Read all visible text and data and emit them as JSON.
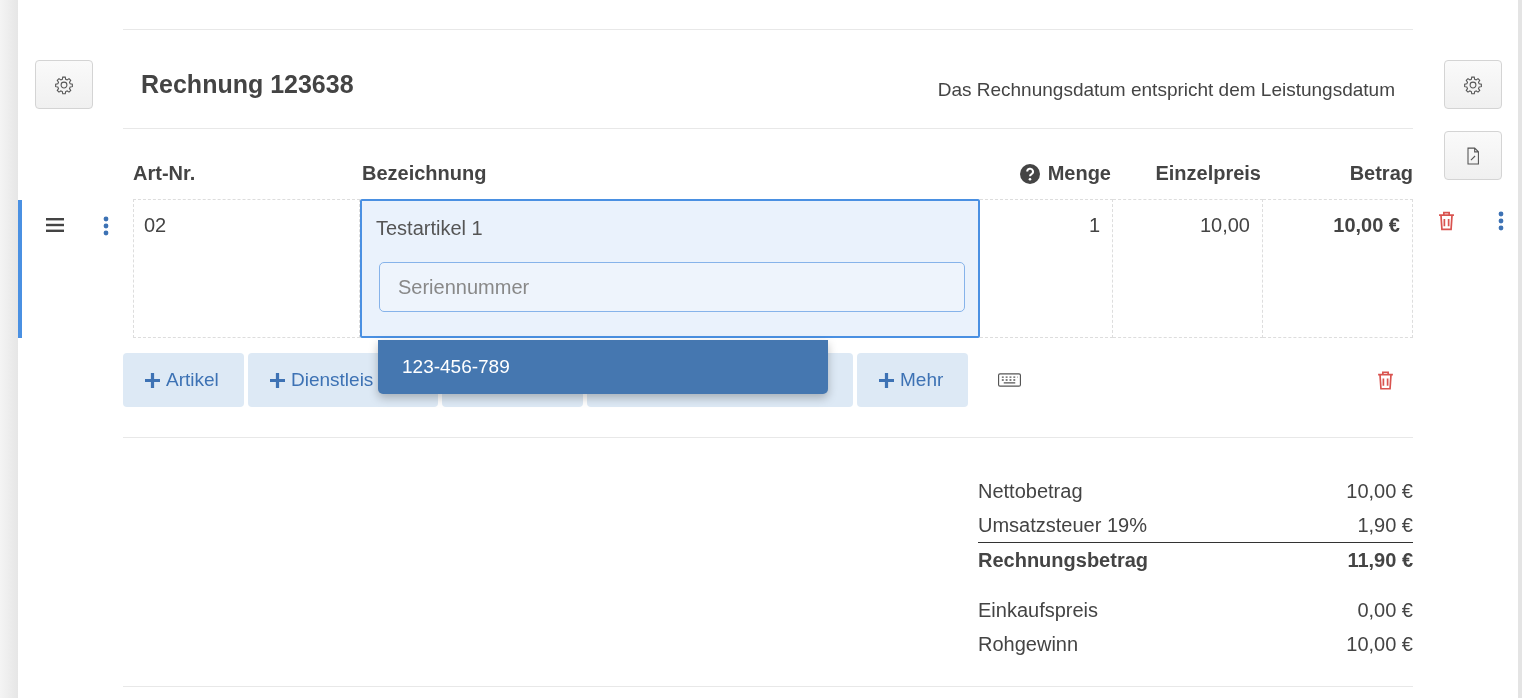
{
  "invoice": {
    "title": "Rechnung 123638",
    "date_note": "Das Rechnungsdatum entspricht dem Leistungsdatum"
  },
  "columns": [
    {
      "label": "Art-Nr.",
      "help": false
    },
    {
      "label": "Bezeichnung",
      "help": false
    },
    {
      "label": "Menge",
      "help": true
    },
    {
      "label": "Einzelpreis",
      "help": false
    },
    {
      "label": "Betrag",
      "help": false
    }
  ],
  "row": {
    "selected": true,
    "art_nr": "02",
    "description": "Testartikel 1",
    "serial_field": {
      "placeholder": "Seriennummer"
    },
    "quantity": "1",
    "unit_price": "10,00",
    "amount": "10,00 €"
  },
  "suggestions": [
    "123-456-789"
  ],
  "add_buttons": [
    {
      "label": "Artikel",
      "plus": true
    },
    {
      "label": "Dienstleis",
      "plus": true
    },
    {
      "plus": false
    },
    {
      "plus": false
    },
    {
      "label": "Mehr",
      "plus": true
    }
  ],
  "totals": [
    {
      "label": "Nettobetrag",
      "value": "10,00 €",
      "kind": "plain"
    },
    {
      "label": "Umsatzsteuer 19%",
      "value": "1,90 €",
      "kind": "plain"
    },
    {
      "label": "Rechnungsbetrag",
      "value": "11,90 €",
      "kind": "total"
    },
    {
      "label": "Einkaufspreis",
      "value": "0,00 €",
      "kind": "gap"
    },
    {
      "label": "Rohgewinn",
      "value": "10,00 €",
      "kind": "plain"
    }
  ]
}
